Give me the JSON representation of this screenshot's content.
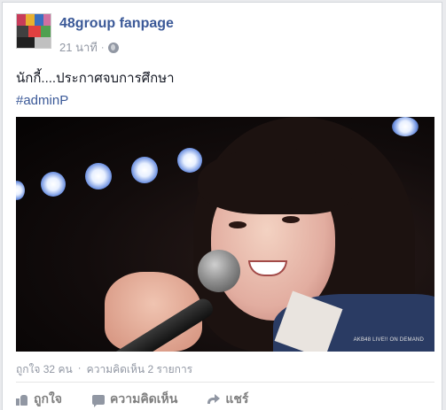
{
  "post": {
    "page_name": "48group fanpage",
    "time": "21 นาที",
    "separator": "·",
    "privacy_icon": "globe-icon",
    "text": "นักกี้....ประกาศจบการศึกษา",
    "hashtag": "#adminP"
  },
  "photo": {
    "watermark": "AKB48 LIVE!! ON DEMAND"
  },
  "stats": {
    "likes": "ถูกใจ 32 คน",
    "separator": "·",
    "comments": "ความคิดเห็น 2 รายการ"
  },
  "actions": {
    "like_label": "ถูกใจ",
    "comment_label": "ความคิดเห็น",
    "share_label": "แชร์"
  },
  "colors": {
    "link_blue": "#3b5998",
    "meta_gray": "#9197a3",
    "background": "#e9eaed"
  }
}
